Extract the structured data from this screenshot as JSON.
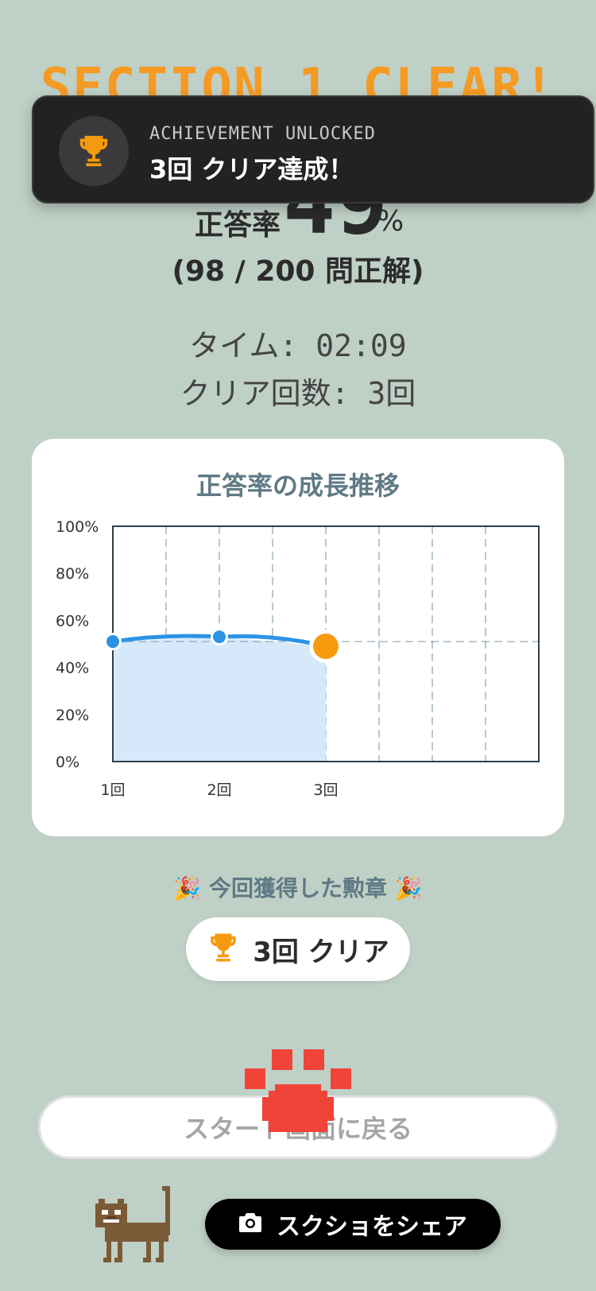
{
  "header": {
    "title": "SECTION 1 CLEAR!"
  },
  "toast": {
    "kicker": "ACHIEVEMENT UNLOCKED",
    "message": "3回 クリア達成！",
    "icon": "trophy-icon"
  },
  "score": {
    "label": "正答率",
    "value": "49",
    "unit": "%",
    "detail": "(98 / 200 問正解)"
  },
  "stats": {
    "time": "タイム: 02:09",
    "clears": "クリア回数: 3回"
  },
  "chart": {
    "title": "正答率の成長推移"
  },
  "chart_data": {
    "type": "line",
    "title": "正答率の成長推移",
    "categories": [
      "1回",
      "2回",
      "3回"
    ],
    "series": [
      {
        "values": [
          51,
          53,
          49
        ]
      }
    ],
    "y_ticks": [
      "0%",
      "20%",
      "40%",
      "60%",
      "80%",
      "100%"
    ],
    "ylim": [
      0,
      100
    ],
    "x_slots": 8,
    "grid": true,
    "reference_line": 51,
    "colors": {
      "line": "#2b93e6",
      "area": "#d6e9fb",
      "current_point": "#f79a0e"
    }
  },
  "medals": {
    "heading": "🎉 今回獲得した勲章 🎉",
    "badge_label": "3回 クリア",
    "badge_icon": "trophy-icon"
  },
  "buttons": {
    "start": "スタート画面に戻る",
    "share": "スクショをシェア",
    "share_icon": "camera-icon"
  },
  "colors": {
    "background": "#bfd0c6",
    "accent": "#f59a23",
    "paw": "#f04438",
    "cat": "#7b5a37"
  }
}
